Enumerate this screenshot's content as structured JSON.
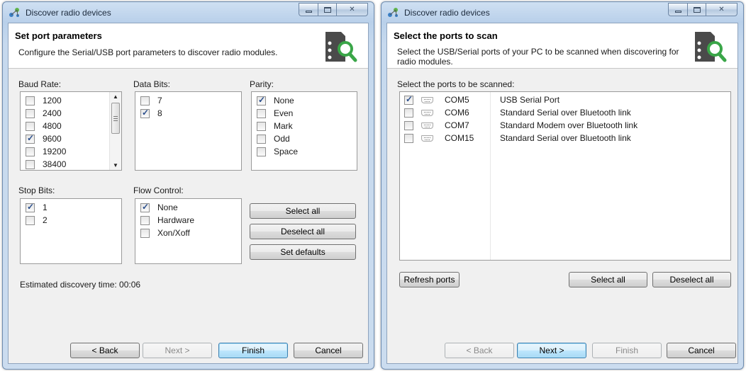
{
  "left_window": {
    "title": "Discover radio devices",
    "header": {
      "title": "Set port parameters",
      "description": "Configure the Serial/USB port parameters to discover radio modules."
    },
    "baud_rate": {
      "label": "Baud Rate:",
      "items": [
        {
          "label": "1200",
          "checked": false
        },
        {
          "label": "2400",
          "checked": false
        },
        {
          "label": "4800",
          "checked": false
        },
        {
          "label": "9600",
          "checked": true
        },
        {
          "label": "19200",
          "checked": false
        },
        {
          "label": "38400",
          "checked": false
        }
      ]
    },
    "data_bits": {
      "label": "Data Bits:",
      "items": [
        {
          "label": "7",
          "checked": false
        },
        {
          "label": "8",
          "checked": true
        }
      ]
    },
    "parity": {
      "label": "Parity:",
      "items": [
        {
          "label": "None",
          "checked": true
        },
        {
          "label": "Even",
          "checked": false
        },
        {
          "label": "Mark",
          "checked": false
        },
        {
          "label": "Odd",
          "checked": false
        },
        {
          "label": "Space",
          "checked": false
        }
      ]
    },
    "stop_bits": {
      "label": "Stop Bits:",
      "items": [
        {
          "label": "1",
          "checked": true
        },
        {
          "label": "2",
          "checked": false
        }
      ]
    },
    "flow_control": {
      "label": "Flow Control:",
      "items": [
        {
          "label": "None",
          "checked": true
        },
        {
          "label": "Hardware",
          "checked": false
        },
        {
          "label": "Xon/Xoff",
          "checked": false
        }
      ]
    },
    "buttons": {
      "select_all": "Select all",
      "deselect_all": "Deselect all",
      "set_defaults": "Set defaults"
    },
    "estimated_time": "Estimated discovery time: 00:06",
    "nav": {
      "back": "< Back",
      "next": "Next >",
      "finish": "Finish",
      "cancel": "Cancel"
    }
  },
  "right_window": {
    "title": "Discover radio devices",
    "header": {
      "title": "Select the ports to scan",
      "description": "Select the USB/Serial ports of your PC to be scanned when discovering for radio modules."
    },
    "ports_label": "Select the ports to be scanned:",
    "ports": [
      {
        "checked": true,
        "port": "COM5",
        "description": "USB Serial Port"
      },
      {
        "checked": false,
        "port": "COM6",
        "description": "Standard Serial over Bluetooth link"
      },
      {
        "checked": false,
        "port": "COM7",
        "description": "Standard Modem over Bluetooth link"
      },
      {
        "checked": false,
        "port": "COM15",
        "description": "Standard Serial over Bluetooth link"
      }
    ],
    "buttons": {
      "refresh_ports": "Refresh ports",
      "select_all": "Select all",
      "deselect_all": "Deselect all"
    },
    "nav": {
      "back": "< Back",
      "next": "Next >",
      "finish": "Finish",
      "cancel": "Cancel"
    }
  },
  "colors": {
    "frame": "#b9d0ea",
    "client": "#f0f0f0",
    "default_button": "#bee6fd",
    "icon_green": "#3aa648",
    "icon_dark": "#4a4a4a"
  },
  "icons": {
    "app": "radio-network-icon",
    "header": "radio-module-search-icon",
    "port": "serial-port-icon"
  }
}
